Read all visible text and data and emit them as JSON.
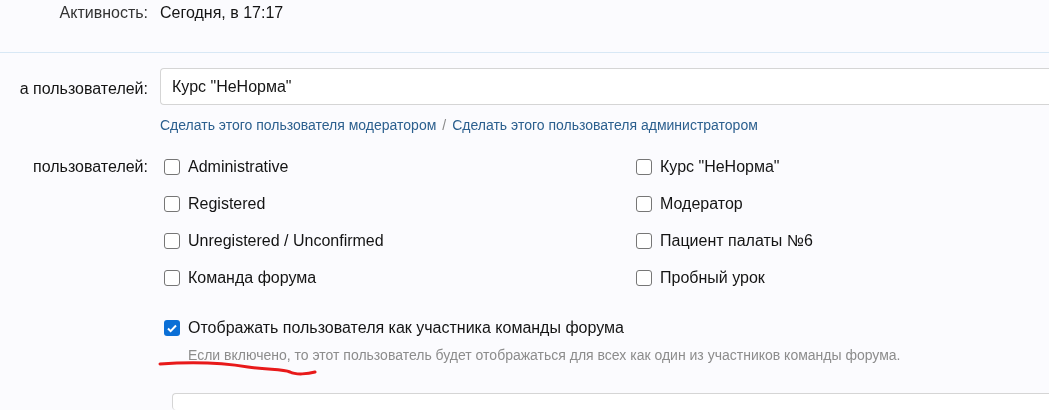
{
  "activity": {
    "label": "Активность:",
    "value": "Сегодня, в 17:17"
  },
  "primary_group": {
    "label": "а пользователей:",
    "value": "Курс \"НеНорма\"",
    "links": [
      "Сделать этого пользователя модератором",
      "Сделать этого пользователя администратором"
    ],
    "separator": "/"
  },
  "secondary_groups": {
    "label": "пользователей:",
    "options": [
      {
        "label": "Administrative",
        "checked": false
      },
      {
        "label": "Registered",
        "checked": false
      },
      {
        "label": "Unregistered / Unconfirmed",
        "checked": false
      },
      {
        "label": "Команда форума",
        "checked": false
      },
      {
        "label": "Курс \"НеНорма\"",
        "checked": false
      },
      {
        "label": "Модератор",
        "checked": false
      },
      {
        "label": "Пациент палаты №6",
        "checked": false
      },
      {
        "label": "Пробный урок",
        "checked": false
      }
    ]
  },
  "staff_option": {
    "label": "Отображать пользователя как участника команды форума",
    "checked": true,
    "hint": "Если включено, то этот пользователь будет отображаться для всех как один из участников команды форума."
  }
}
